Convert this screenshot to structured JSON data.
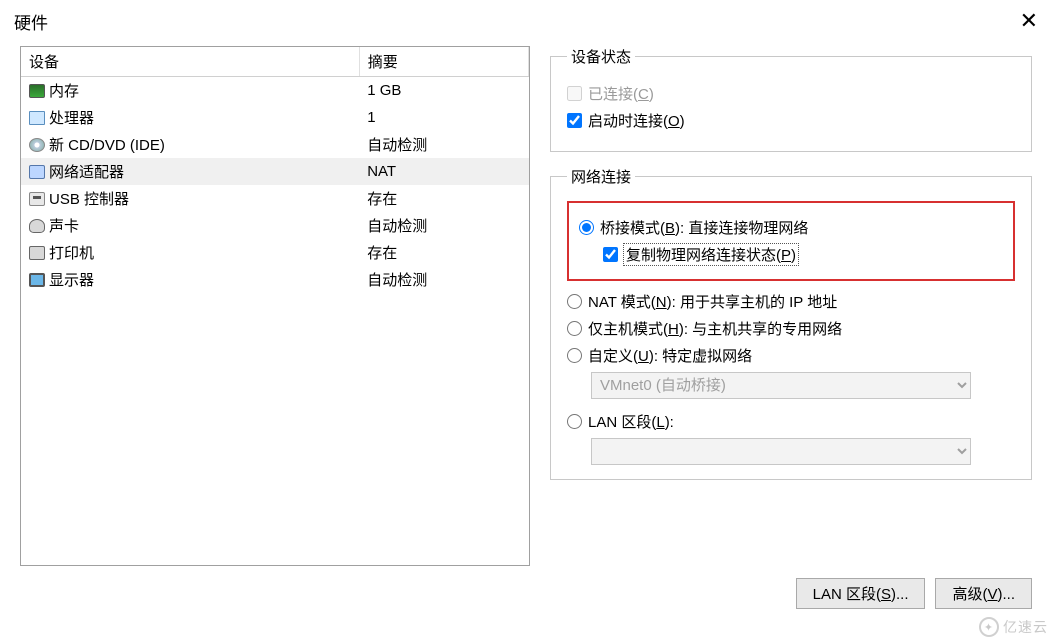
{
  "title": "硬件",
  "deviceTable": {
    "header_device": "设备",
    "header_summary": "摘要",
    "rows": [
      {
        "name": "内存",
        "summary": "1 GB",
        "icon": "ic-mem",
        "selected": false
      },
      {
        "name": "处理器",
        "summary": "1",
        "icon": "ic-cpu",
        "selected": false
      },
      {
        "name": "新 CD/DVD (IDE)",
        "summary": "自动检测",
        "icon": "ic-cd",
        "selected": false
      },
      {
        "name": "网络适配器",
        "summary": "NAT",
        "icon": "ic-net",
        "selected": true
      },
      {
        "name": "USB 控制器",
        "summary": "存在",
        "icon": "ic-usb",
        "selected": false
      },
      {
        "name": "声卡",
        "summary": "自动检测",
        "icon": "ic-snd",
        "selected": false
      },
      {
        "name": "打印机",
        "summary": "存在",
        "icon": "ic-prn",
        "selected": false
      },
      {
        "name": "显示器",
        "summary": "自动检测",
        "icon": "ic-mon",
        "selected": false
      }
    ]
  },
  "deviceState": {
    "legend": "设备状态",
    "connected_label_pre": "已连接(",
    "connected_key": "C",
    "connected_label_post": ")",
    "connect_at_poweron_pre": "启动时连接(",
    "connect_at_poweron_key": "O",
    "connect_at_poweron_post": ")"
  },
  "netConn": {
    "legend": "网络连接",
    "bridged_pre": "桥接模式(",
    "bridged_key": "B",
    "bridged_post": "): 直接连接物理网络",
    "replicate_pre": "复制物理网络连接状态(",
    "replicate_key": "P",
    "replicate_post": ")",
    "nat_pre": "NAT 模式(",
    "nat_key": "N",
    "nat_post": "): 用于共享主机的 IP 地址",
    "hostonly_pre": "仅主机模式(",
    "hostonly_key": "H",
    "hostonly_post": "): 与主机共享的专用网络",
    "custom_pre": "自定义(",
    "custom_key": "U",
    "custom_post": "): 特定虚拟网络",
    "custom_option": "VMnet0 (自动桥接)",
    "lan_pre": "LAN 区段(",
    "lan_key": "L",
    "lan_post": "):",
    "lan_option": ""
  },
  "buttons": {
    "lan_segments_pre": "LAN 区段(",
    "lan_segments_key": "S",
    "lan_segments_post": ")...",
    "advanced_pre": "高级(",
    "advanced_key": "V",
    "advanced_post": ")..."
  },
  "watermark": "亿速云"
}
